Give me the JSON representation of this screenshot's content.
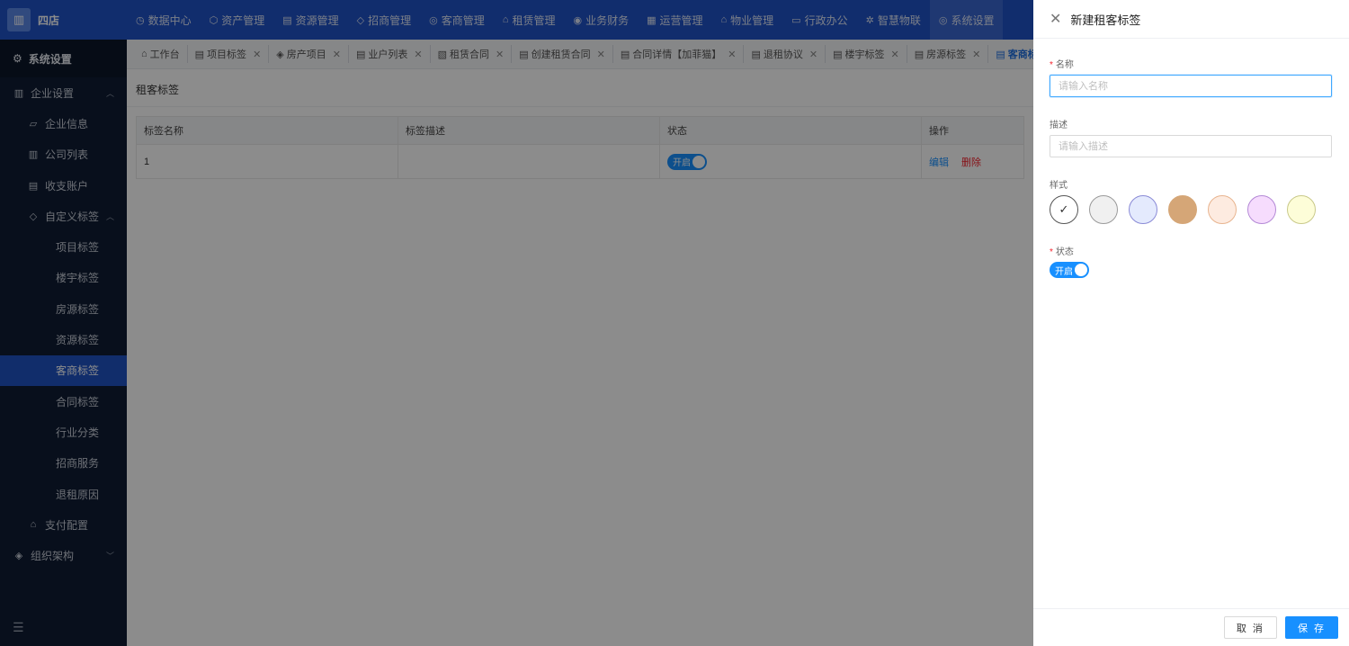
{
  "app": {
    "name": "四店",
    "logo_icon": "building-icon"
  },
  "topnav": [
    {
      "label": "数据中心",
      "icon": "◷"
    },
    {
      "label": "资产管理",
      "icon": "⬡"
    },
    {
      "label": "资源管理",
      "icon": "▤"
    },
    {
      "label": "招商管理",
      "icon": "◇"
    },
    {
      "label": "客商管理",
      "icon": "◎"
    },
    {
      "label": "租赁管理",
      "icon": "⌂"
    },
    {
      "label": "业务财务",
      "icon": "◉"
    },
    {
      "label": "运营管理",
      "icon": "▦"
    },
    {
      "label": "物业管理",
      "icon": "⌂"
    },
    {
      "label": "行政办公",
      "icon": "▭"
    },
    {
      "label": "智慧物联",
      "icon": "✲"
    },
    {
      "label": "系统设置",
      "icon": "◎"
    }
  ],
  "sidebar": {
    "header": "系统设置",
    "enterprise": "企业设置",
    "enterprise_items": [
      "企业信息",
      "公司列表",
      "收支账户"
    ],
    "custom_tags": "自定义标签",
    "tag_items": [
      "项目标签",
      "楼宇标签",
      "房源标签",
      "资源标签",
      "客商标签",
      "合同标签",
      "行业分类",
      "招商服务",
      "退租原因"
    ],
    "payment": "支付配置",
    "org": "组织架构"
  },
  "tabs": [
    {
      "label": "工作台",
      "icon": "⌂"
    },
    {
      "label": "项目标签",
      "icon": "▤"
    },
    {
      "label": "房产项目",
      "icon": "◈"
    },
    {
      "label": "业户列表",
      "icon": "▤"
    },
    {
      "label": "租赁合同",
      "icon": "▧"
    },
    {
      "label": "创建租赁合同",
      "icon": "▤"
    },
    {
      "label": "合同详情【加菲猫】",
      "icon": "▤"
    },
    {
      "label": "退租协议",
      "icon": "▤"
    },
    {
      "label": "楼宇标签",
      "icon": "▤"
    },
    {
      "label": "房源标签",
      "icon": "▤"
    },
    {
      "label": "客商标",
      "icon": "▤"
    }
  ],
  "page": {
    "title": "租客标签",
    "columns": [
      "标签名称",
      "标签描述",
      "状态",
      "操作"
    ],
    "rows": [
      {
        "name": "1",
        "desc": "",
        "status": "开启",
        "edit": "编辑",
        "delete": "删除"
      }
    ]
  },
  "drawer": {
    "title": "新建租客标签",
    "name_label": "名称",
    "name_placeholder": "请输入名称",
    "desc_label": "描述",
    "desc_placeholder": "请输入描述",
    "style_label": "样式",
    "swatches": [
      {
        "color": "#ffffff",
        "border": "#555555",
        "selected": true
      },
      {
        "color": "#f0f0f0",
        "border": "#9a9a9a"
      },
      {
        "color": "#e4eafd",
        "border": "#8a8ad6"
      },
      {
        "color": "#d5a677",
        "border": "#d5a677"
      },
      {
        "color": "#fdebe0",
        "border": "#e8b48f"
      },
      {
        "color": "#f6dcfd",
        "border": "#b48ad6"
      },
      {
        "color": "#fdfdd8",
        "border": "#c9c98a"
      }
    ],
    "status_label": "状态",
    "status_value": "开启",
    "cancel": "取 消",
    "save": "保 存"
  }
}
